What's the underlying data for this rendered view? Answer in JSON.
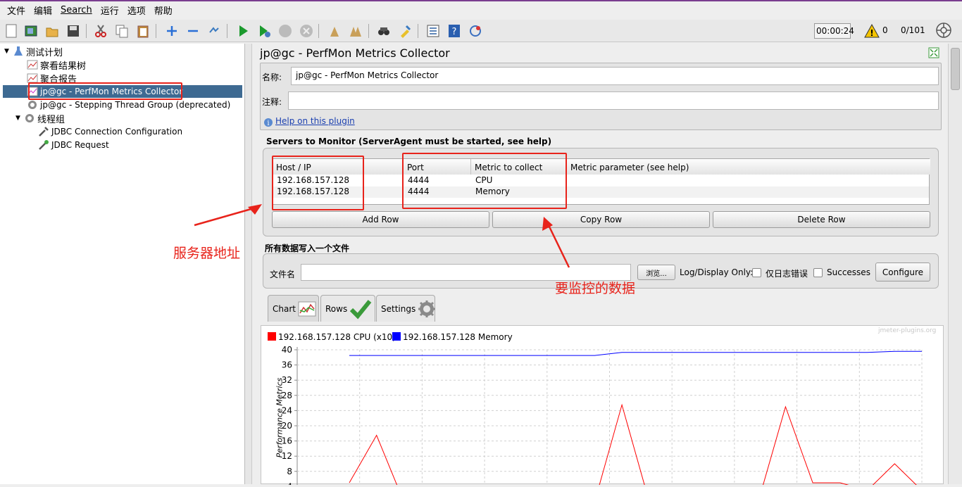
{
  "menu": [
    "文件",
    "编辑",
    "Search",
    "运行",
    "选项",
    "帮助"
  ],
  "toolbar": {
    "timer": "00:00:24",
    "warn_count": "0",
    "threads": "0/101",
    "icons": [
      "new-icon",
      "templates-icon",
      "open-icon",
      "save-icon",
      "cut-icon",
      "copy-icon",
      "paste-icon",
      "expand-icon",
      "collapse-icon",
      "toggle-icon",
      "start-icon",
      "start-no-pause-icon",
      "stop-icon",
      "shutdown-icon",
      "clear-icon",
      "clear-all-icon",
      "search-icon",
      "reset-search-icon",
      "function-helper-icon",
      "help-icon",
      "remote-icon"
    ]
  },
  "tree": {
    "test_plan": "测试计划",
    "view_results_tree": "察看结果树",
    "aggregate_report": "聚合报告",
    "perfmon": "jp@gc - PerfMon Metrics Collector",
    "stepping": "jp@gc - Stepping Thread Group (deprecated)",
    "thread_group": "线程组",
    "jdbc_config": "JDBC Connection Configuration",
    "jdbc_request": "JDBC Request"
  },
  "panel": {
    "title": "jp@gc - PerfMon Metrics Collector",
    "name_label": "名称:",
    "name_value": "jp@gc - PerfMon Metrics Collector",
    "comment_label": "注释:",
    "comment_value": "",
    "help_link": "Help on this plugin",
    "servers_title": "Servers to Monitor (ServerAgent must be started, see help)",
    "columns": [
      "Host / IP",
      "Port",
      "Metric to collect",
      "Metric parameter (see help)"
    ],
    "rows": [
      [
        "192.168.157.128",
        "4444",
        "CPU",
        ""
      ],
      [
        "192.168.157.128",
        "4444",
        "Memory",
        ""
      ]
    ],
    "add_row": "Add Row",
    "copy_row": "Copy Row",
    "delete_row": "Delete Row",
    "write_all_title": "所有数据写入一个文件",
    "filename_label": "文件名",
    "filename_value": "",
    "browse": "浏览...",
    "log_display": "Log/Display Only:",
    "errors_only": "仅日志错误",
    "successes": "Successes",
    "configure": "Configure"
  },
  "annotations": {
    "server_addr": "服务器地址",
    "metrics": "要监控的数据"
  },
  "tabs": [
    "Chart",
    "Rows",
    "Settings"
  ],
  "chart_data": {
    "type": "line",
    "watermark": "jmeter-plugins.org",
    "ylabel": "Performance Metrics",
    "yticks": [
      40,
      36,
      32,
      28,
      24,
      20,
      16,
      12,
      8,
      4
    ],
    "ylim": [
      0,
      40
    ],
    "series": [
      {
        "name": "192.168.157.128 CPU (x10)",
        "color": "#ff0000",
        "values": [
          5,
          17.5,
          0,
          3,
          3,
          3,
          0,
          3,
          3,
          0,
          25.5,
          0,
          0,
          3,
          3,
          0,
          25,
          5,
          5,
          3,
          10,
          3
        ]
      },
      {
        "name": "192.168.157.128 Memory",
        "color": "#0000ff",
        "values": [
          38.5,
          38.5,
          38.5,
          38.5,
          38.5,
          38.5,
          38.5,
          38.5,
          38.5,
          38.5,
          39.3,
          39.3,
          39.3,
          39.3,
          39.3,
          39.3,
          39.3,
          39.3,
          39.3,
          39.3,
          39.6,
          39.6
        ]
      }
    ]
  }
}
